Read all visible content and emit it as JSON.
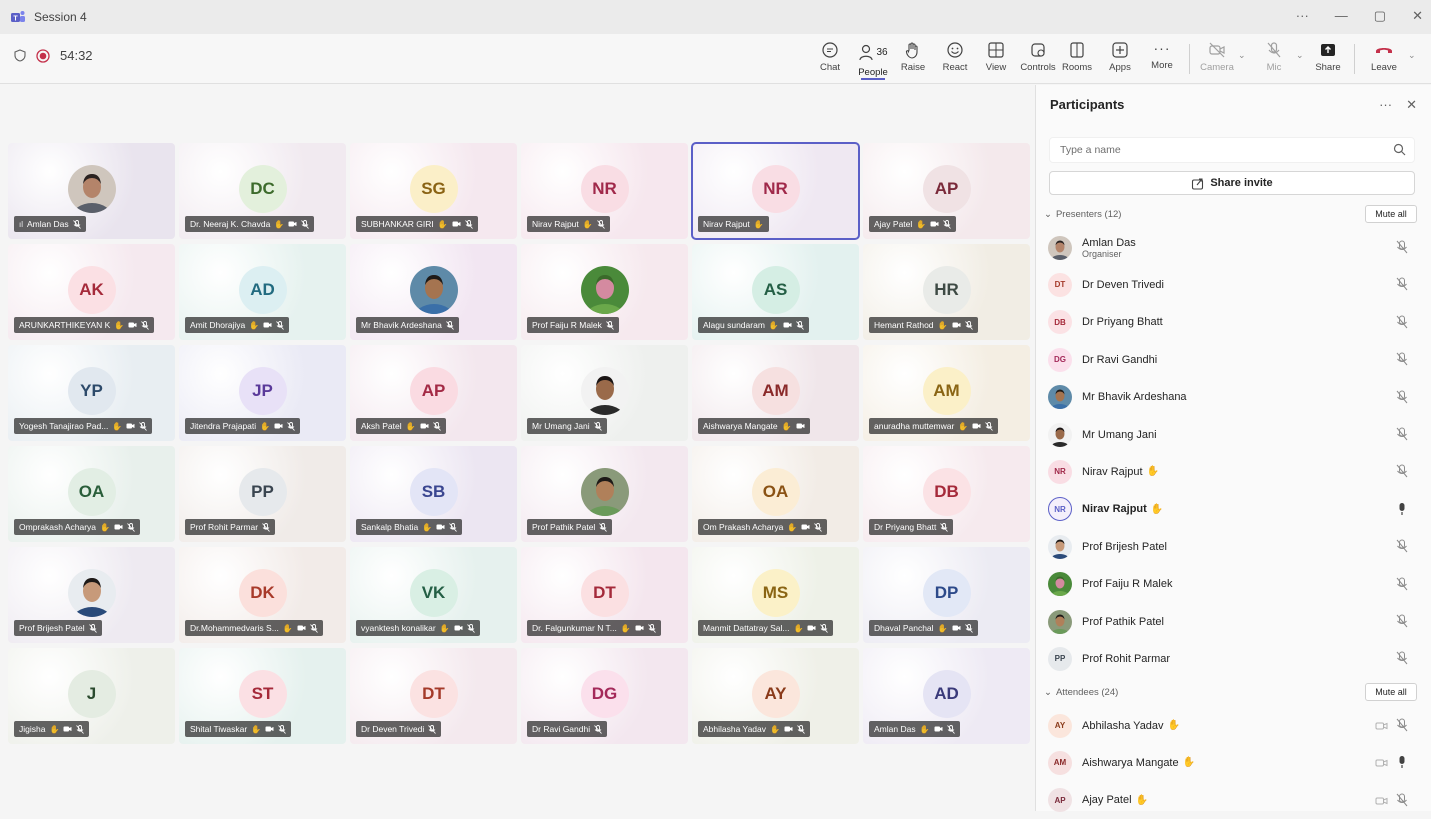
{
  "window": {
    "title": "Session 4",
    "controls": [
      "···",
      "—",
      "▢",
      "✕"
    ]
  },
  "toolbar": {
    "timer": "54:32",
    "people_count": "36",
    "buttons": [
      {
        "key": "chat",
        "label": "Chat"
      },
      {
        "key": "people",
        "label": "People"
      },
      {
        "key": "raise",
        "label": "Raise"
      },
      {
        "key": "react",
        "label": "React"
      },
      {
        "key": "view",
        "label": "View"
      },
      {
        "key": "controls",
        "label": "Controls"
      },
      {
        "key": "rooms",
        "label": "Rooms"
      },
      {
        "key": "apps",
        "label": "Apps"
      },
      {
        "key": "more",
        "label": "More"
      },
      {
        "key": "camera",
        "label": "Camera"
      },
      {
        "key": "mic",
        "label": "Mic"
      },
      {
        "key": "share",
        "label": "Share"
      },
      {
        "key": "leave",
        "label": "Leave"
      }
    ]
  },
  "tiles": [
    {
      "name": "Amlan Das",
      "initials": "",
      "photo": "amlan",
      "bg": "#e9e4ee",
      "avatar_bg": "",
      "avatar_fg": "",
      "icons": "mic",
      "signal": true
    },
    {
      "name": "Dr. Neeraj K. Chavda",
      "initials": "DC",
      "bg": "#f1eaf0",
      "avatar_bg": "#e3f0dc",
      "avatar_fg": "#3d6b2c",
      "icons": "hand-cam-mic"
    },
    {
      "name": "SUBHANKAR GIRI",
      "initials": "SG",
      "bg": "#f5e8ef",
      "avatar_bg": "#fbefc8",
      "avatar_fg": "#8a6314",
      "icons": "hand-cam-mic"
    },
    {
      "name": "Nirav Rajput",
      "initials": "NR",
      "bg": "#f6e7ee",
      "avatar_bg": "#f9dde4",
      "avatar_fg": "#a0294a",
      "icons": "hand-mic"
    },
    {
      "name": "Nirav Rajput",
      "initials": "NR",
      "bg": "#efe8f2",
      "avatar_bg": "#f9dde4",
      "avatar_fg": "#a0294a",
      "icons": "hand",
      "selected": true
    },
    {
      "name": "Ajay Patel",
      "initials": "AP",
      "bg": "#f4e9ec",
      "avatar_bg": "#f0e2e4",
      "avatar_fg": "#7a2a3a",
      "icons": "hand-cam-mic"
    },
    {
      "name": "ARUNKARTHIKEYAN K",
      "initials": "AK",
      "bg": "#f5e9ef",
      "avatar_bg": "#fbe0e4",
      "avatar_fg": "#a52a3a",
      "icons": "hand-cam-mic"
    },
    {
      "name": "Amit Dhorajiya",
      "initials": "AD",
      "bg": "#e6f2ef",
      "avatar_bg": "#dceff2",
      "avatar_fg": "#226b80",
      "icons": "hand-cam-mic"
    },
    {
      "name": "Mr Bhavik Ardeshana",
      "initials": "",
      "photo": "bhavik",
      "bg": "#f2e6f2",
      "icons": "mic"
    },
    {
      "name": "Prof Faiju R Malek",
      "initials": "",
      "photo": "faiju",
      "bg": "#f6e9ee",
      "icons": "mic"
    },
    {
      "name": "Alagu sundaram",
      "initials": "AS",
      "bg": "#e3f1ef",
      "avatar_bg": "#d5eee4",
      "avatar_fg": "#245f45",
      "icons": "hand-cam-mic"
    },
    {
      "name": "Hemant Rathod",
      "initials": "HR",
      "bg": "#f1ede4",
      "avatar_bg": "#e9ebe8",
      "avatar_fg": "#3e4a44",
      "icons": "hand-cam-mic"
    },
    {
      "name": "Yogesh Tanajirao Pad...",
      "initials": "YP",
      "bg": "#e8eef2",
      "avatar_bg": "#e1e8ef",
      "avatar_fg": "#2d4a6a",
      "icons": "hand-cam-mic"
    },
    {
      "name": "Jitendra Prajapati",
      "initials": "JP",
      "bg": "#eaeaf5",
      "avatar_bg": "#e8e1f7",
      "avatar_fg": "#5a3a9a",
      "icons": "hand-cam-mic"
    },
    {
      "name": "Aksh Patel",
      "initials": "AP",
      "bg": "#f3e7ee",
      "avatar_bg": "#fadbe2",
      "avatar_fg": "#a32a45",
      "icons": "hand-cam-mic"
    },
    {
      "name": "Mr Umang Jani",
      "initials": "",
      "photo": "umang",
      "bg": "#eef0ee",
      "icons": "mic"
    },
    {
      "name": "Aishwarya Mangate",
      "initials": "AM",
      "bg": "#f0e6ea",
      "avatar_bg": "#f6e0e0",
      "avatar_fg": "#8a2a2a",
      "icons": "hand-cam"
    },
    {
      "name": "anuradha muttemwar",
      "initials": "AM",
      "bg": "#f4eee3",
      "avatar_bg": "#fbf0c8",
      "avatar_fg": "#8a6514",
      "icons": "hand-cam-mic"
    },
    {
      "name": "Omprakash Acharya",
      "initials": "OA",
      "bg": "#e8f0ec",
      "avatar_bg": "#e2eee4",
      "avatar_fg": "#2a5e3a",
      "icons": "hand-cam-mic"
    },
    {
      "name": "Prof Rohit Parmar",
      "initials": "PP",
      "bg": "#f0ebe8",
      "avatar_bg": "#e6e9ec",
      "avatar_fg": "#3a4550",
      "icons": "mic"
    },
    {
      "name": "Sankalp Bhatia",
      "initials": "SB",
      "bg": "#ece6f2",
      "avatar_bg": "#e3e5f6",
      "avatar_fg": "#3a4690",
      "icons": "hand-cam-mic"
    },
    {
      "name": "Prof Pathik Patel",
      "initials": "",
      "photo": "pathik",
      "bg": "#f3e8ef",
      "icons": "mic"
    },
    {
      "name": "Om Prakash Acharya",
      "initials": "OA",
      "bg": "#f2ece6",
      "avatar_bg": "#fbedd5",
      "avatar_fg": "#8a5214",
      "icons": "hand-cam-mic"
    },
    {
      "name": "Dr Priyang Bhatt",
      "initials": "DB",
      "bg": "#f6eaee",
      "avatar_bg": "#fbe2e5",
      "avatar_fg": "#a52a3a",
      "icons": "mic"
    },
    {
      "name": "Prof Brijesh Patel",
      "initials": "",
      "photo": "brijesh",
      "bg": "#eeeaf1",
      "icons": "mic"
    },
    {
      "name": "Dr.Mohammedvaris S...",
      "initials": "DK",
      "bg": "#f2ebe8",
      "avatar_bg": "#fbe0dc",
      "avatar_fg": "#a83a2a",
      "icons": "hand-cam-mic"
    },
    {
      "name": "vyanktesh konalikar",
      "initials": "VK",
      "bg": "#e6f1ee",
      "avatar_bg": "#d9efe4",
      "avatar_fg": "#245f45",
      "icons": "hand-cam-mic"
    },
    {
      "name": "Dr. Falgunkumar N T...",
      "initials": "DT",
      "bg": "#f4e6ee",
      "avatar_bg": "#fbe0e2",
      "avatar_fg": "#a42a3a",
      "icons": "hand-cam-mic"
    },
    {
      "name": "Manmit Dattatray Sal...",
      "initials": "MS",
      "bg": "#eef1e8",
      "avatar_bg": "#fbf1c8",
      "avatar_fg": "#8a6514",
      "icons": "hand-cam-mic"
    },
    {
      "name": "Dhaval Panchal",
      "initials": "DP",
      "bg": "#ecebf3",
      "avatar_bg": "#e2e8f6",
      "avatar_fg": "#2d4a8a",
      "icons": "hand-cam-mic"
    },
    {
      "name": "Jigisha",
      "initials": "J",
      "bg": "#eef0ea",
      "avatar_bg": "#e4ece2",
      "avatar_fg": "#2a4a2e",
      "icons": "hand-cam-mic"
    },
    {
      "name": "Shital Tiwaskar",
      "initials": "ST",
      "bg": "#e5f1ee",
      "avatar_bg": "#fbe0e4",
      "avatar_fg": "#a52a3a",
      "icons": "hand-cam-mic"
    },
    {
      "name": "Dr Deven Trivedi",
      "initials": "DT",
      "bg": "#f4e9ee",
      "avatar_bg": "#fbe2e2",
      "avatar_fg": "#a43a2a",
      "icons": "mic"
    },
    {
      "name": "Dr Ravi Gandhi",
      "initials": "DG",
      "bg": "#f3e7ef",
      "avatar_bg": "#fbe0ec",
      "avatar_fg": "#a42a5a",
      "icons": "mic"
    },
    {
      "name": "Abhilasha Yadav",
      "initials": "AY",
      "bg": "#eff0e8",
      "avatar_bg": "#fbe6dc",
      "avatar_fg": "#8a3a1a",
      "icons": "hand-cam-mic"
    },
    {
      "name": "Amlan Das",
      "initials": "AD",
      "bg": "#eeeaf4",
      "avatar_bg": "#e5e4f4",
      "avatar_fg": "#3a3a7a",
      "icons": "hand-cam-mic"
    }
  ],
  "panel": {
    "title": "Participants",
    "search_placeholder": "Type a name",
    "share_invite": "Share invite",
    "presenters_label": "Presenters (12)",
    "attendees_label": "Attendees (24)",
    "mute_all": "Mute all",
    "presenters": [
      {
        "name": "Amlan Das",
        "sub": "Organiser",
        "initials": "",
        "photo": "amlan",
        "mic": "off"
      },
      {
        "name": "Dr Deven Trivedi",
        "initials": "DT",
        "avatar_bg": "#fbe2e2",
        "avatar_fg": "#a43a2a",
        "mic": "off"
      },
      {
        "name": "Dr Priyang Bhatt",
        "initials": "DB",
        "avatar_bg": "#fbe2e5",
        "avatar_fg": "#a52a3a",
        "mic": "off"
      },
      {
        "name": "Dr Ravi Gandhi",
        "initials": "DG",
        "avatar_bg": "#fbe0ec",
        "avatar_fg": "#a42a5a",
        "mic": "off"
      },
      {
        "name": "Mr Bhavik Ardeshana",
        "initials": "",
        "photo": "bhavik",
        "mic": "off"
      },
      {
        "name": "Mr Umang Jani",
        "initials": "",
        "photo": "umang",
        "mic": "off"
      },
      {
        "name": "Nirav Rajput",
        "initials": "NR",
        "avatar_bg": "#f9dde4",
        "avatar_fg": "#a0294a",
        "mic": "off",
        "hand": true
      },
      {
        "name": "Nirav Rajput",
        "initials": "NR",
        "avatar_bg": "#f4effb",
        "avatar_fg": "#5b5fc7",
        "mic": "on",
        "hand": true,
        "bold": true,
        "ring": true
      },
      {
        "name": "Prof Brijesh Patel",
        "initials": "",
        "photo": "brijesh",
        "mic": "off"
      },
      {
        "name": "Prof Faiju R Malek",
        "initials": "",
        "photo": "faiju",
        "mic": "off"
      },
      {
        "name": "Prof Pathik Patel",
        "initials": "",
        "photo": "pathik",
        "mic": "off"
      },
      {
        "name": "Prof Rohit Parmar",
        "initials": "PP",
        "avatar_bg": "#e6e9ec",
        "avatar_fg": "#3a4550",
        "mic": "off"
      }
    ],
    "attendees": [
      {
        "name": "Abhilasha Yadav",
        "initials": "AY",
        "avatar_bg": "#fbe6dc",
        "avatar_fg": "#8a3a1a",
        "mic": "off",
        "hand": true,
        "cam": true
      },
      {
        "name": "Aishwarya Mangate",
        "initials": "AM",
        "avatar_bg": "#f6e0e0",
        "avatar_fg": "#8a2a2a",
        "mic": "on",
        "hand": true,
        "cam": true
      },
      {
        "name": "Ajay Patel",
        "initials": "AP",
        "avatar_bg": "#f0e2e4",
        "avatar_fg": "#7a2a3a",
        "mic": "off",
        "hand": true,
        "cam": true
      }
    ]
  }
}
